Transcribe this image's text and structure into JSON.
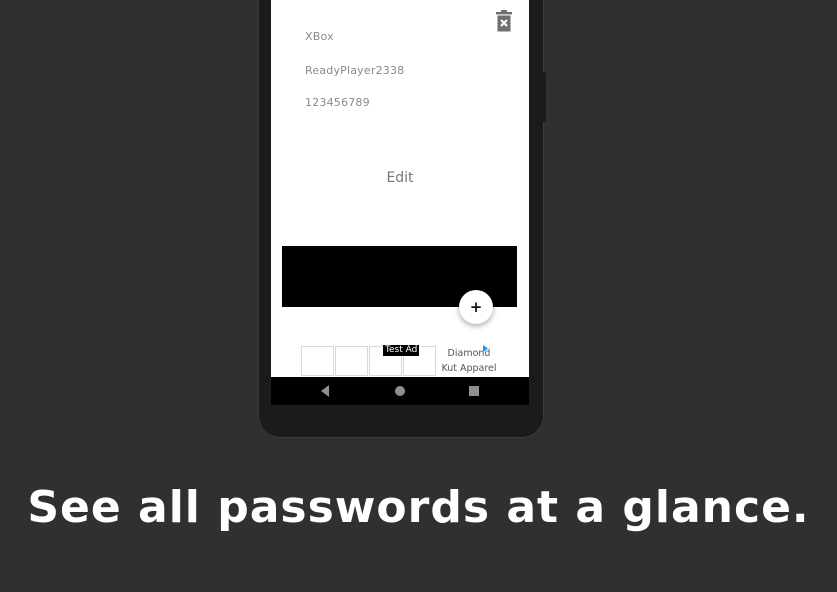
{
  "entry": {
    "site": "XBox",
    "username": "ReadyPlayer2338",
    "password": "123456789",
    "edit_label": "Edit"
  },
  "ad": {
    "badge": "Test Ad",
    "line1": "Diamond",
    "line2": "Kut Apparel"
  },
  "fab_label": "+",
  "caption": "See all passwords at a glance.",
  "icons": {
    "delete": "delete-icon",
    "add": "plus-icon",
    "back": "back-icon",
    "home": "home-icon",
    "recents": "recents-icon",
    "ad_choices": "ad-choices-icon"
  },
  "colors": {
    "background": "#2f3031",
    "screen": "#ffffff",
    "banner": "#000000",
    "caption": "#ffffff"
  }
}
